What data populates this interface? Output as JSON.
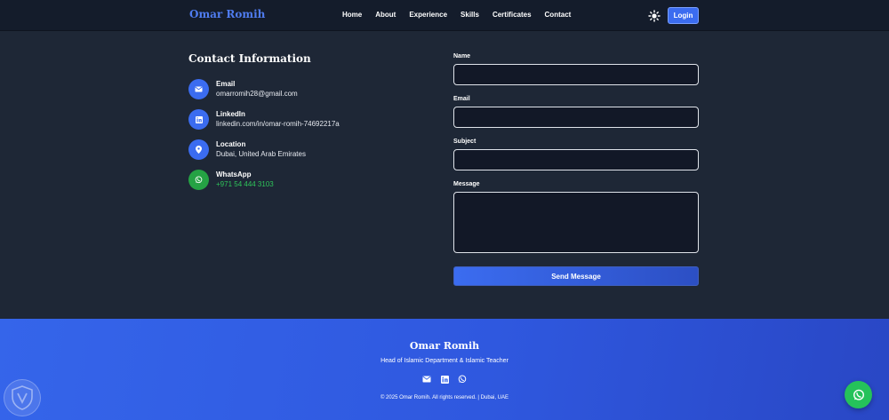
{
  "nav": {
    "brand": "Omar Romih",
    "links": [
      "Home",
      "About",
      "Experience",
      "Skills",
      "Certificates",
      "Contact"
    ],
    "login_label": "Login",
    "theme_icon": "sun-icon"
  },
  "contact": {
    "heading": "Contact Information",
    "items": [
      {
        "title": "Email",
        "value": "omarromih28@gmail.com",
        "icon": "mail-icon"
      },
      {
        "title": "LinkedIn",
        "value": "linkedin.com/in/omar-romih-74692217a",
        "icon": "linkedin-icon"
      },
      {
        "title": "Location",
        "value": "Dubai, United Arab Emirates",
        "icon": "location-pin-icon"
      },
      {
        "title": "WhatsApp",
        "value": "+971 54 444 3103",
        "icon": "whatsapp-icon"
      }
    ]
  },
  "form": {
    "name_label": "Name",
    "name_value": "",
    "email_label": "Email",
    "email_value": "",
    "subject_label": "Subject",
    "subject_value": "",
    "message_label": "Message",
    "message_value": "",
    "submit_label": "Send Message"
  },
  "footer": {
    "name": "Omar Romih",
    "role": "Head of Islamic Department & Islamic Teacher",
    "copyright": "© 2025 Omar Romih. All rights reserved. | Dubai, UAE",
    "icons": [
      "mail-icon",
      "linkedin-icon",
      "whatsapp-icon"
    ]
  },
  "colors": {
    "accent": "#3b6cf0",
    "background": "#1e2736",
    "navbar": "#141c2b",
    "whatsapp": "#25c25a"
  }
}
